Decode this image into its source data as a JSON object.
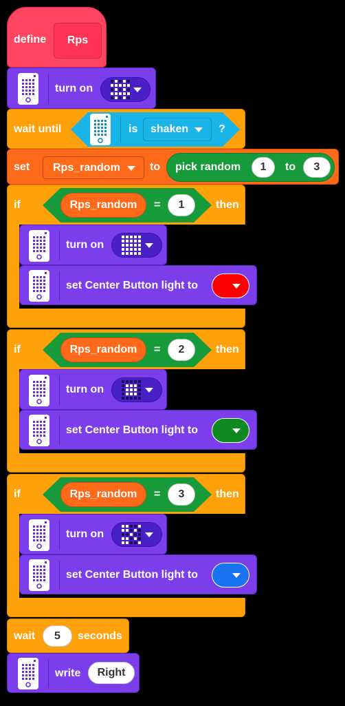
{
  "colors": {
    "define": "#FF4560",
    "display": "#7C3EEB",
    "control": "#FFA10A",
    "variable": "#FF6A1A",
    "operator": "#179B3A",
    "sensor": "#19B4E8",
    "red_light": "#FF0000",
    "green_light": "#0E8A20",
    "blue_light": "#1A73F0"
  },
  "define": {
    "label": "define",
    "name": "Rps"
  },
  "turn_on_1": {
    "icon": "hub-icon",
    "label": "turn on",
    "matrix": [
      [
        0,
        1,
        0,
        1,
        0
      ],
      [
        1,
        1,
        1,
        1,
        1
      ],
      [
        0,
        1,
        0,
        1,
        0
      ],
      [
        1,
        1,
        1,
        1,
        1
      ],
      [
        0,
        1,
        0,
        1,
        0
      ]
    ]
  },
  "wait_until": {
    "label": "wait until",
    "icon": "hub-icon",
    "is": "is",
    "option": "shaken",
    "question": "?"
  },
  "set_var": {
    "label": "set",
    "variable": "Rps_random",
    "to": "to",
    "pick_random": "pick random",
    "min": "1",
    "to2": "to",
    "max": "3"
  },
  "if_blocks": [
    {
      "if": "if",
      "variable": "Rps_random",
      "eq": "=",
      "value": "1",
      "then": "then",
      "turn_on": "turn on",
      "matrix": [
        [
          1,
          1,
          1,
          1,
          1
        ],
        [
          1,
          1,
          1,
          1,
          1
        ],
        [
          1,
          1,
          1,
          1,
          1
        ],
        [
          1,
          1,
          1,
          1,
          1
        ],
        [
          1,
          1,
          1,
          1,
          1
        ]
      ],
      "light_label": "set Center Button light to",
      "light_color": "red"
    },
    {
      "if": "if",
      "variable": "Rps_random",
      "eq": "=",
      "value": "2",
      "then": "then",
      "turn_on": "turn on",
      "matrix": [
        [
          0,
          0,
          0,
          0,
          0
        ],
        [
          0,
          1,
          1,
          1,
          0
        ],
        [
          0,
          1,
          1,
          1,
          0
        ],
        [
          0,
          1,
          1,
          1,
          0
        ],
        [
          0,
          0,
          0,
          0,
          0
        ]
      ],
      "light_label": "set Center Button light to",
      "light_color": "green"
    },
    {
      "if": "if",
      "variable": "Rps_random",
      "eq": "=",
      "value": "3",
      "then": "then",
      "turn_on": "turn on",
      "matrix": [
        [
          1,
          1,
          0,
          0,
          1
        ],
        [
          1,
          1,
          0,
          1,
          0
        ],
        [
          0,
          0,
          1,
          0,
          0
        ],
        [
          1,
          1,
          0,
          1,
          0
        ],
        [
          1,
          1,
          0,
          0,
          1
        ]
      ],
      "light_label": "set Center Button light to",
      "light_color": "blue"
    }
  ],
  "wait": {
    "label": "wait",
    "value": "5",
    "unit": "seconds"
  },
  "write": {
    "label": "write",
    "value": "Right"
  }
}
